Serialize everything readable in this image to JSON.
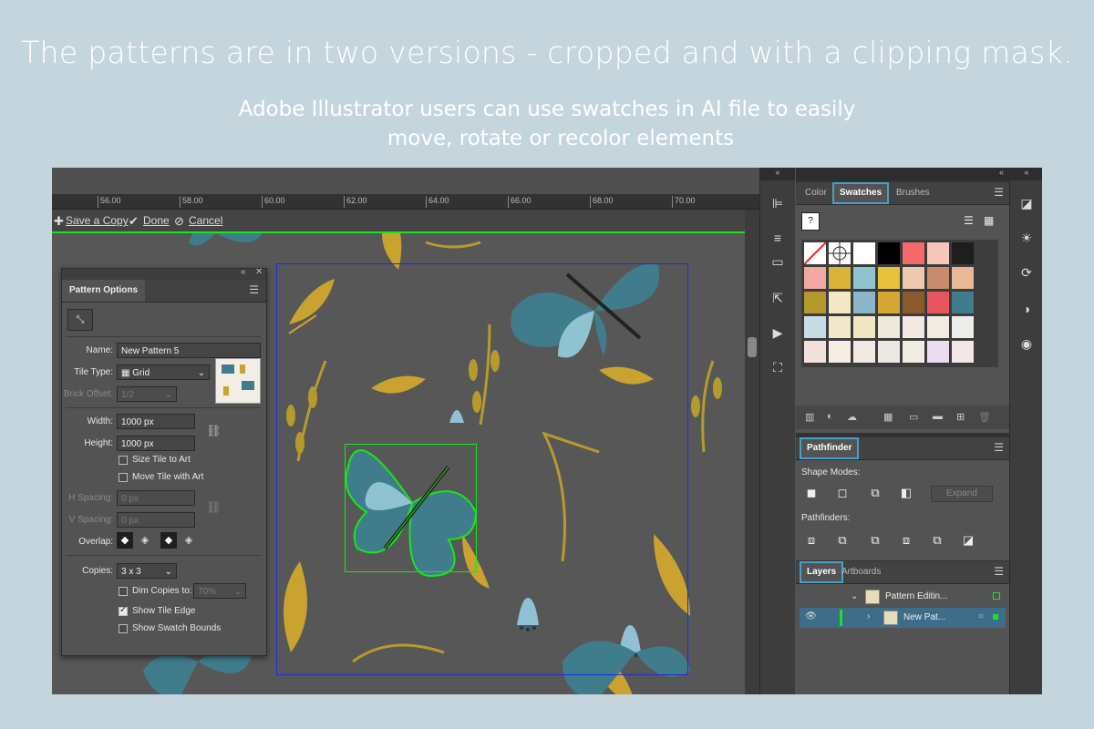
{
  "headline": "The patterns are in two versions - cropped and with a clipping mask.",
  "subtitle_line1": "Adobe Illustrator users can use swatches in AI file to easily",
  "subtitle_line2": "move, rotate or recolor elements",
  "ruler_ticks": [
    "56.00",
    "58.00",
    "60.00",
    "62.00",
    "64.00",
    "66.00",
    "68.00",
    "70.00"
  ],
  "edit_bar": {
    "save_copy": "Save a Copy",
    "done": "Done",
    "cancel": "Cancel"
  },
  "pattern_options": {
    "title": "Pattern Options",
    "name_label": "Name:",
    "name_value": "New Pattern 5",
    "tile_type_label": "Tile Type:",
    "tile_type_value": "Grid",
    "brick_offset_label": "Brick Offset:",
    "brick_offset_value": "1/2",
    "width_label": "Width:",
    "width_value": "1000 px",
    "height_label": "Height:",
    "height_value": "1000 px",
    "size_tile_to_art": "Size Tile to Art",
    "move_tile_with_art": "Move Tile with Art",
    "h_spacing_label": "H Spacing:",
    "h_spacing_value": "0 px",
    "v_spacing_label": "V Spacing:",
    "v_spacing_value": "0 px",
    "overlap_label": "Overlap:",
    "copies_label": "Copies:",
    "copies_value": "3 x 3",
    "dim_copies_label": "Dim Copies to:",
    "dim_copies_value": "70%",
    "show_tile_edge": "Show Tile Edge",
    "show_swatch_bounds": "Show Swatch Bounds",
    "size_tile_checked": false,
    "move_tile_checked": false,
    "dim_copies_checked": false,
    "show_tile_edge_checked": true,
    "show_swatch_bounds_checked": false
  },
  "swatch_panel": {
    "tabs": [
      "Color",
      "Swatches",
      "Brushes"
    ],
    "active_tab": "Swatches",
    "colors": [
      "#ffffff",
      "#ffffff",
      "#ffffff",
      "#000000",
      "#f26a6a",
      "#f5c7b8",
      "#1e1e1e",
      "#f2a7a0",
      "#d9b33a",
      "#8fc3d1",
      "#e6c23a",
      "#eec9b0",
      "#c98b6b",
      "#e9b894",
      "#b39a2a",
      "#f4e7c4",
      "#8ab7c9",
      "#d4a832",
      "#8b5a2b",
      "#e9555e",
      "#3f7d8c",
      "#c9dce6",
      "#f3e8c8",
      "#f2e7c4",
      "#efe9dc",
      "#f4e8e3",
      "#f1ebe4",
      "#ecece8",
      "#f3e1dc",
      "#f6ede4",
      "#f2e9e3",
      "#ece8e2",
      "#f3ece1",
      "#eaddf0",
      "#f3e6e6"
    ]
  },
  "pathfinder": {
    "title": "Pathfinder",
    "shape_modes": "Shape Modes:",
    "expand": "Expand",
    "pathfinders": "Pathfinders:"
  },
  "layers": {
    "tabs": [
      "Layers",
      "Artboards"
    ],
    "active_tab": "Layers",
    "row1": "Pattern Editin...",
    "row2": "New Pat..."
  }
}
